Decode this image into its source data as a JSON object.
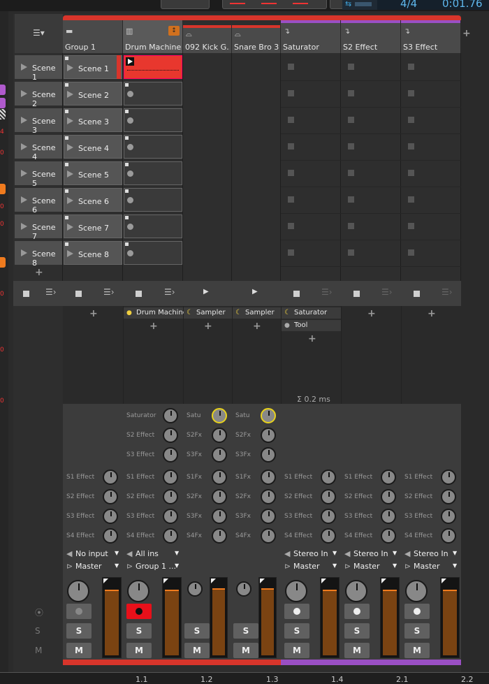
{
  "transport": {
    "time_sig": "4/4",
    "time": "0:01.76"
  },
  "left_strip": {
    "numbers": [
      "4",
      "0",
      "0",
      "0",
      "0",
      "0",
      "0"
    ]
  },
  "scene_list": {
    "header_icon": "list-menu-icon",
    "scenes": [
      "Scene 1",
      "Scene 2",
      "Scene 3",
      "Scene 4",
      "Scene 5",
      "Scene 6",
      "Scene 7",
      "Scene 8"
    ],
    "add": "+"
  },
  "tracks": [
    {
      "name": "Group 1",
      "icon": "folder-icon",
      "color": "#d8352b",
      "clips": [
        "Scene 1",
        "Scene 2",
        "Scene 3",
        "Scene 4",
        "Scene 5",
        "Scene 6",
        "Scene 7",
        "Scene 8"
      ]
    },
    {
      "name": "Drum Machine",
      "icon": "drum-machine-icon",
      "color": "#d8352b"
    },
    {
      "name": "092 Kick G...",
      "icon": "audio-track-icon",
      "color": "#d8352b"
    },
    {
      "name": "Snare Bro 3",
      "icon": "audio-track-icon",
      "color": "#d8352b"
    },
    {
      "name": "Saturator",
      "icon": "effect-track-icon",
      "color": "#9a4fc4"
    },
    {
      "name": "S2 Effect",
      "icon": "effect-track-icon",
      "color": "#9a4fc4"
    },
    {
      "name": "S3 Effect",
      "icon": "effect-track-icon",
      "color": "#9a4fc4"
    }
  ],
  "devices": {
    "drum_machine": "Drum Machine",
    "kick": "Sampler",
    "snare": "Sampler",
    "saturator": "Saturator",
    "saturator_tool": "Tool",
    "latency": "Σ 0.2 ms"
  },
  "sends": {
    "group": [
      "S1 Effect",
      "S2 Effect",
      "S3 Effect",
      "S4 Effect"
    ],
    "drum_top": [
      "Saturator",
      "S2 Effect",
      "S3 Effect"
    ],
    "drum": [
      "S1 Effect",
      "S2 Effect",
      "S3 Effect",
      "S4 Effect"
    ],
    "short_top": [
      "Satu",
      "S2Fx",
      "S3Fx"
    ],
    "short": [
      "S1Fx",
      "S2Fx",
      "S3Fx",
      "S4Fx"
    ],
    "fx": [
      "S1 Effect",
      "S2 Effect",
      "S3 Effect",
      "S4 Effect"
    ]
  },
  "io": {
    "group_in": "No input",
    "group_out": "Master",
    "drum_in": "All ins",
    "drum_out": "Group 1 ...",
    "fx_in": "Stereo In",
    "fx_out": "Master"
  },
  "buttons": {
    "solo": "S",
    "mute": "M"
  },
  "footer_icons": [
    "record-arm-icon",
    "solo-icon",
    "mute-icon"
  ],
  "footer_labels": {
    "solo": "S",
    "mute": "M"
  },
  "ruler": {
    "marks": [
      "1.1",
      "1.2",
      "1.3",
      "1.4",
      "2.1",
      "2.2"
    ]
  },
  "colors": {
    "group": "#d8352b",
    "effect": "#9a4fc4",
    "meter": "#f07b1e",
    "record": "#e8101a",
    "highlight_knob": "#e8d21c"
  }
}
